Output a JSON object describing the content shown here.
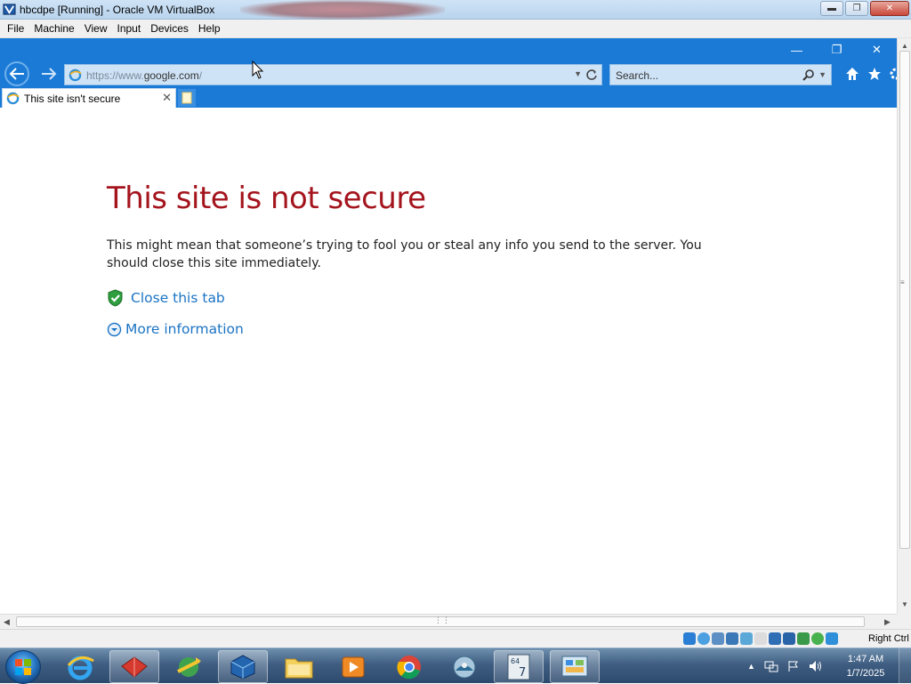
{
  "vbox": {
    "window_title": "hbcdpe [Running] - Oracle VM VirtualBox",
    "menu": [
      "File",
      "Machine",
      "View",
      "Input",
      "Devices",
      "Help"
    ],
    "host_key": "Right Ctrl"
  },
  "browser": {
    "address": {
      "prefix": "https://www.",
      "domain": "google.com",
      "suffix": "/"
    },
    "search_placeholder": "Search...",
    "tab_title": "This site isn't secure",
    "accent_color": "#1a7ad6"
  },
  "page": {
    "headline": "This site is not secure",
    "description": "This might mean that someone’s trying to fool you or steal any info you send to the server. You should close this site immediately.",
    "close_link": "Close this tab",
    "more_link": "More information",
    "headline_color": "#a4141d",
    "link_color": "#1a73c4"
  },
  "taskbar": {
    "pinned": [
      "internet-explorer",
      "red-app",
      "network-app",
      "virtualbox",
      "file-explorer",
      "media-player",
      "chrome",
      "satellite-app",
      "win7-64-app",
      "control-panel"
    ],
    "clock": {
      "time": "1:47 AM",
      "date": "1/7/2025"
    }
  }
}
